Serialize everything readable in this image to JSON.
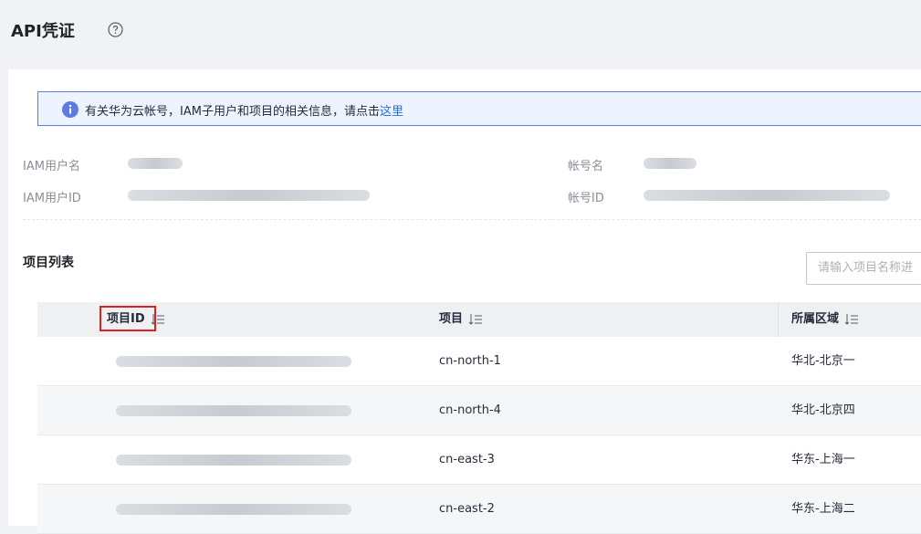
{
  "header": {
    "title": "API凭证"
  },
  "info": {
    "text": "有关华为云帐号，IAM子用户和项目的相关信息，请点击",
    "link": "这里"
  },
  "account": {
    "iam_user_name_label": "IAM用户名",
    "iam_user_id_label": "IAM用户ID",
    "account_name_label": "帐号名",
    "account_id_label": "帐号ID"
  },
  "projects": {
    "title": "项目列表",
    "search_placeholder": "请输入项目名称进",
    "columns": [
      "项目ID",
      "项目",
      "所属区域"
    ],
    "rows": [
      {
        "project": "cn-north-1",
        "region": "华北-北京一"
      },
      {
        "project": "cn-north-4",
        "region": "华北-北京四"
      },
      {
        "project": "cn-east-3",
        "region": "华东-上海一"
      },
      {
        "project": "cn-east-2",
        "region": "华东-上海二"
      }
    ]
  },
  "colors": {
    "accent": "#1e6fe7",
    "info_border": "#5e7ce0",
    "highlight": "#e02020"
  }
}
